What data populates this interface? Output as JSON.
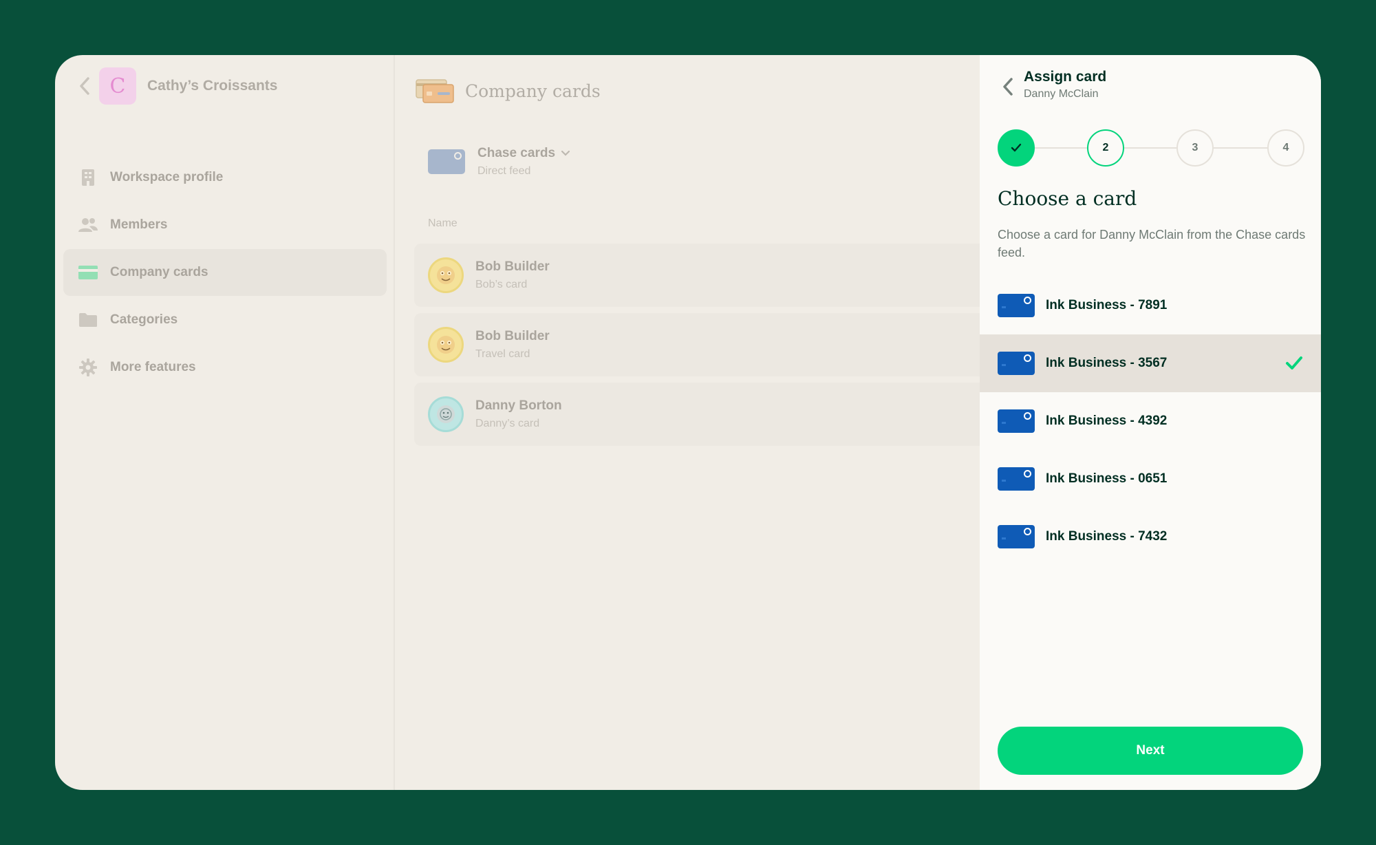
{
  "workspace": {
    "initial": "C",
    "name": "Cathy’s Croissants"
  },
  "sidebar": {
    "items": [
      {
        "label": "Workspace profile",
        "icon": "building-icon"
      },
      {
        "label": "Members",
        "icon": "users-icon"
      },
      {
        "label": "Company cards",
        "icon": "credit-card-icon",
        "active": true
      },
      {
        "label": "Categories",
        "icon": "folder-icon"
      },
      {
        "label": "More features",
        "icon": "gear-icon"
      }
    ]
  },
  "content": {
    "title": "Company cards",
    "feed": {
      "name": "Chase cards",
      "subtitle": "Direct feed"
    },
    "column_header": "Name",
    "rows": [
      {
        "name": "Bob Builder",
        "card": "Bob’s card"
      },
      {
        "name": "Bob Builder",
        "card": "Travel card"
      },
      {
        "name": "Danny Borton",
        "card": "Danny’s card"
      }
    ]
  },
  "panel": {
    "title": "Assign card",
    "subtitle": "Danny McClain",
    "steps": [
      {
        "label": "",
        "state": "done"
      },
      {
        "label": "2",
        "state": "current"
      },
      {
        "label": "3",
        "state": "upcoming"
      },
      {
        "label": "4",
        "state": "upcoming"
      }
    ],
    "heading": "Choose a card",
    "description": "Choose a card for Danny McClain from the Chase cards feed.",
    "cards": [
      {
        "label": "Ink Business - 7891",
        "selected": false
      },
      {
        "label": "Ink Business - 3567",
        "selected": true
      },
      {
        "label": "Ink Business - 4392",
        "selected": false
      },
      {
        "label": "Ink Business - 0651",
        "selected": false
      },
      {
        "label": "Ink Business - 7432",
        "selected": false
      }
    ],
    "next_label": "Next"
  },
  "colors": {
    "background": "#08503a",
    "accent_green": "#03d47c",
    "text_dark": "#002e22",
    "card_blue": "#0f5bb6",
    "workspace_avatar": "#f3d1ea"
  }
}
